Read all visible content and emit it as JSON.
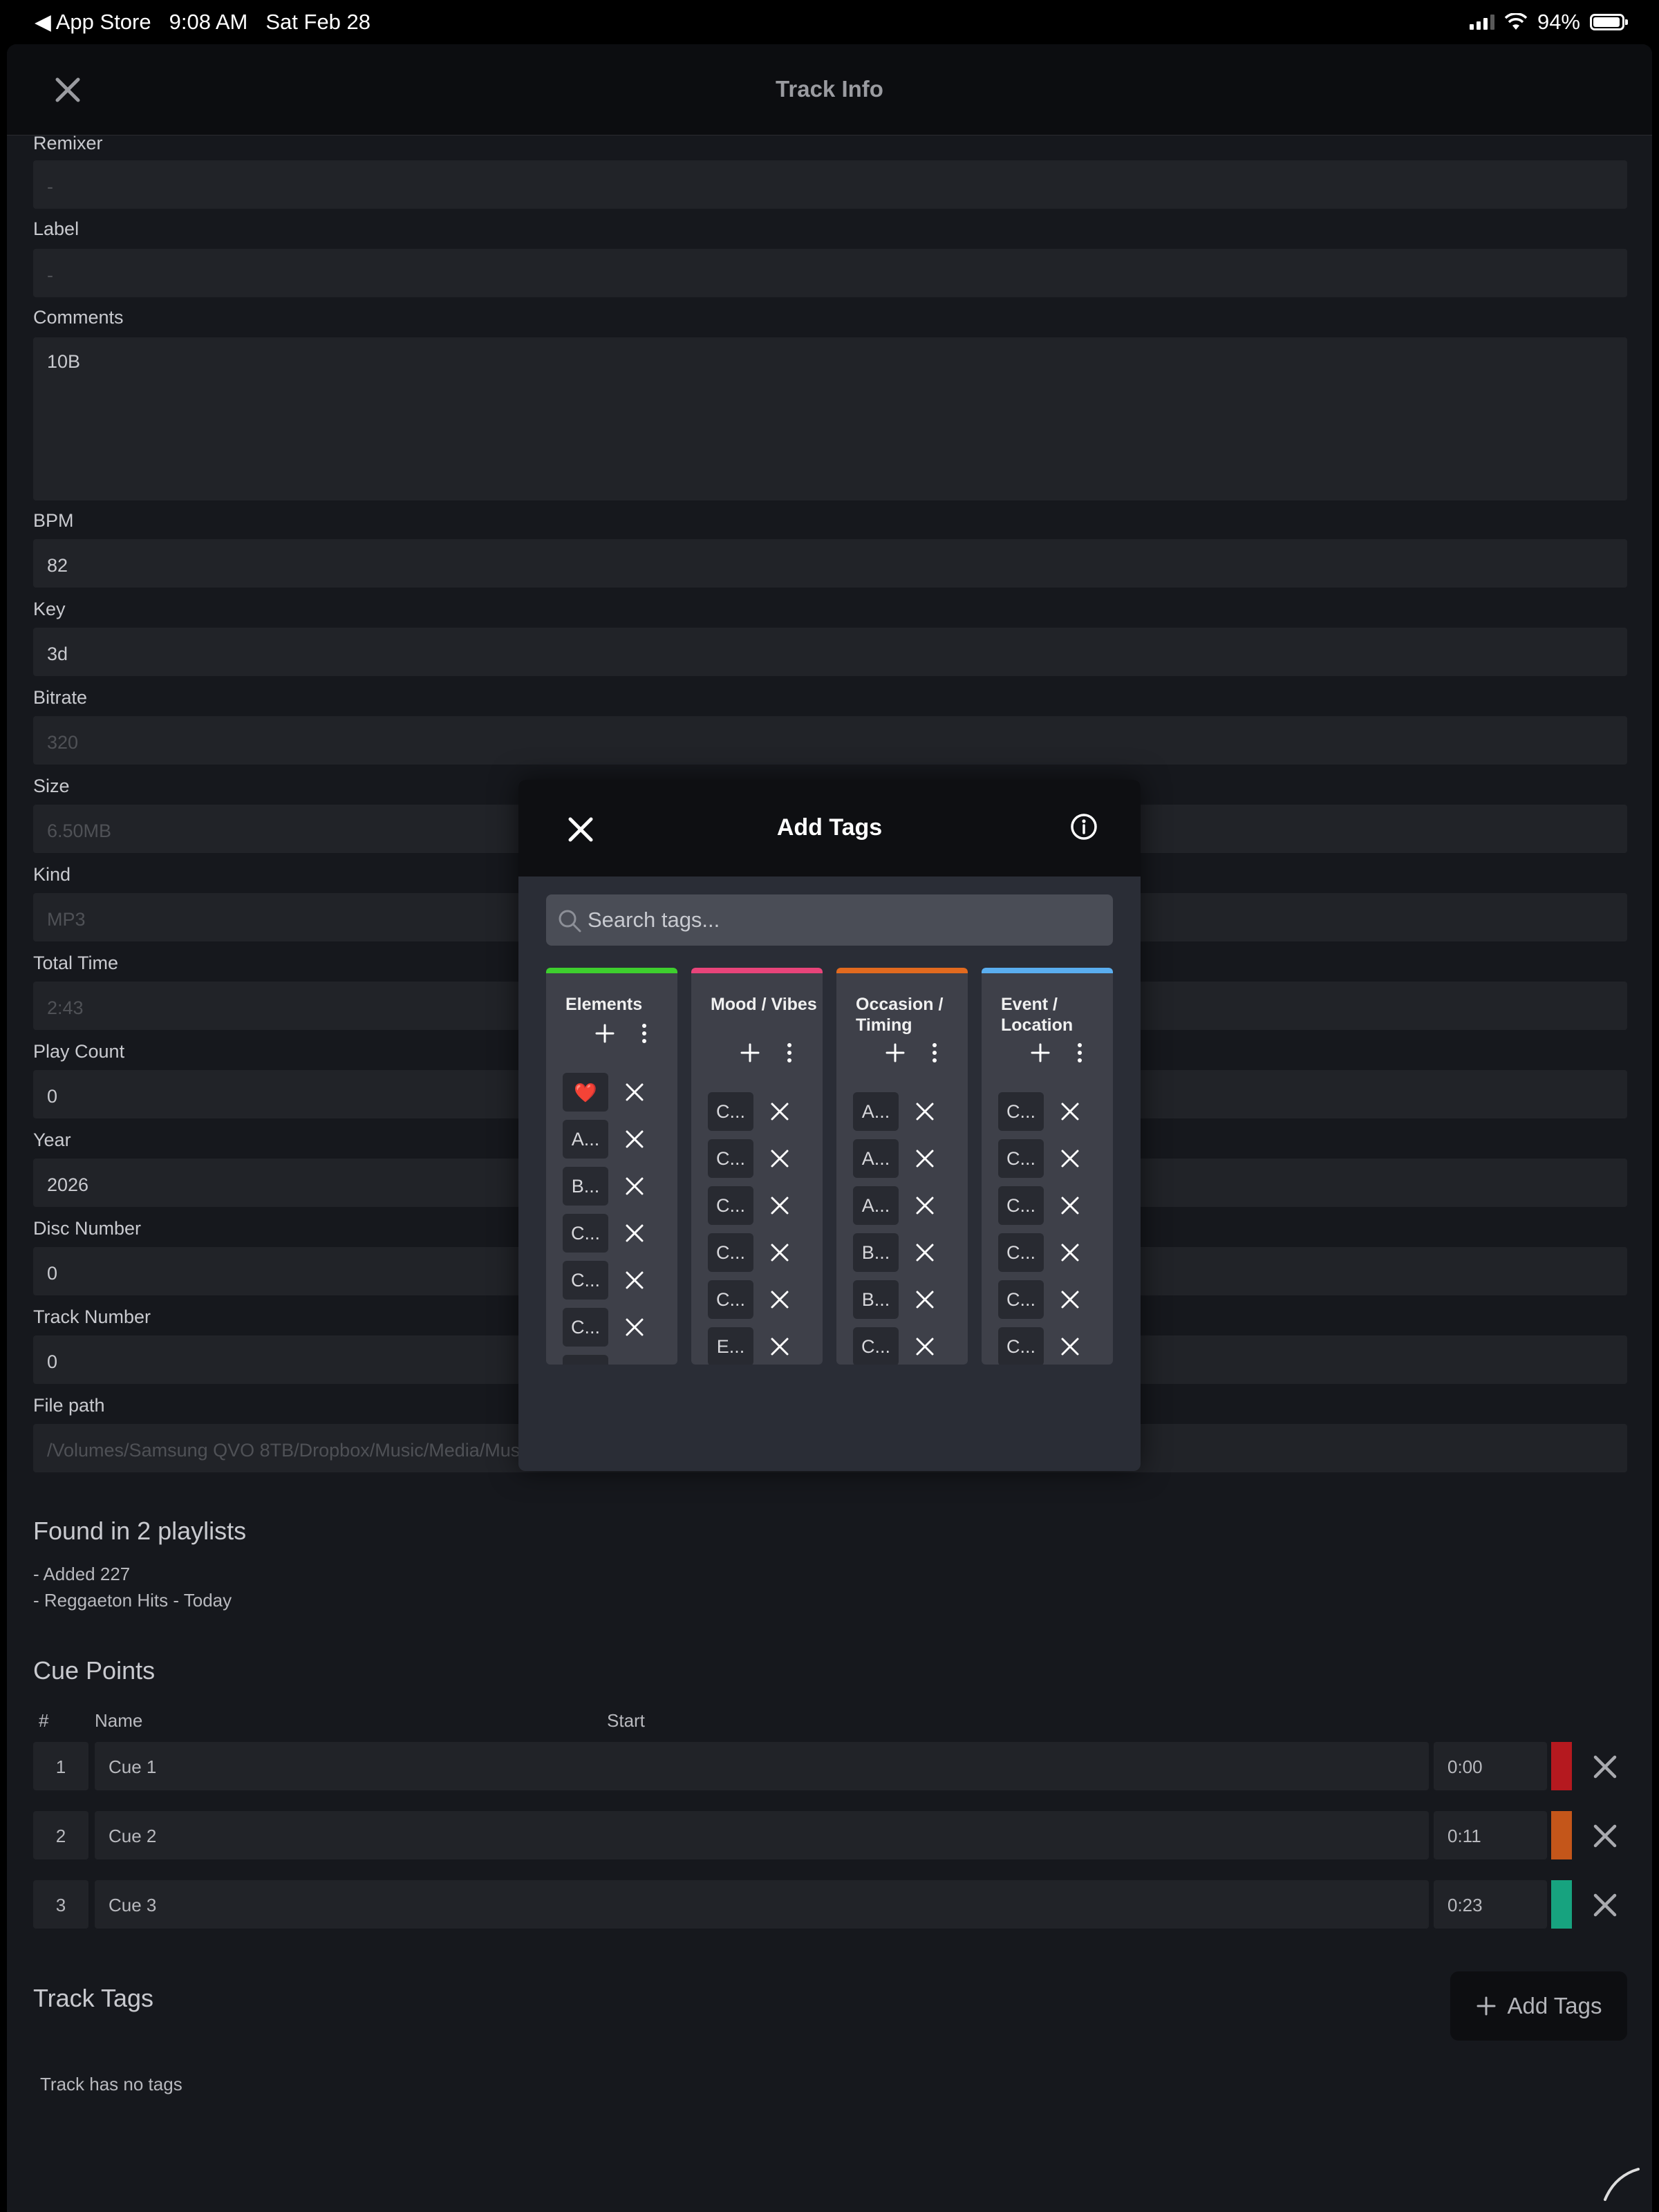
{
  "status_bar": {
    "back_app": "◀ App Store",
    "time": "9:08 AM",
    "date": "Sat Feb 28",
    "battery": "94%",
    "battery_fraction": 0.94
  },
  "header": {
    "title": "Track Info"
  },
  "fields": {
    "remixer": {
      "label": "Remixer",
      "value": "-"
    },
    "label": {
      "label": "Label",
      "value": "-"
    },
    "comments": {
      "label": "Comments",
      "value": "10B"
    },
    "bpm": {
      "label": "BPM",
      "value": "82"
    },
    "key": {
      "label": "Key",
      "value": "3d"
    },
    "bitrate": {
      "label": "Bitrate",
      "value": "320"
    },
    "size": {
      "label": "Size",
      "value": "6.50MB"
    },
    "kind": {
      "label": "Kind",
      "value": "MP3"
    },
    "total_time": {
      "label": "Total Time",
      "value": "2:43"
    },
    "play_count": {
      "label": "Play Count",
      "value": "0"
    },
    "year": {
      "label": "Year",
      "value": "2026"
    },
    "disc_number": {
      "label": "Disc Number",
      "value": "0"
    },
    "track_number": {
      "label": "Track Number",
      "value": "0"
    },
    "file_path": {
      "label": "File path",
      "value": "/Volumes/Samsung QVO 8TB/Dropbox/Music/Media/Music"
    }
  },
  "playlists": {
    "title": "Found in 2 playlists",
    "items": [
      "- Added 227",
      "- Reggaeton Hits - Today"
    ]
  },
  "cue_points": {
    "title": "Cue Points",
    "headers": {
      "num": "#",
      "name": "Name",
      "start": "Start"
    },
    "rows": [
      {
        "num": "1",
        "name": "Cue 1",
        "start": "0:00",
        "color": "#b5191f"
      },
      {
        "num": "2",
        "name": "Cue 2",
        "start": "0:11",
        "color": "#c4561a"
      },
      {
        "num": "3",
        "name": "Cue 3",
        "start": "0:23",
        "color": "#17a37f"
      }
    ]
  },
  "track_tags": {
    "title": "Track Tags",
    "add_button": "Add Tags",
    "empty_text": "Track has no tags"
  },
  "modal": {
    "title": "Add Tags",
    "search_placeholder": "Search tags...",
    "columns": [
      {
        "title": "Elements",
        "color": "#3ecf2e",
        "tags": [
          "❤️",
          "A...",
          "B...",
          "C...",
          "C...",
          "C..."
        ]
      },
      {
        "title": "Mood / Vibes",
        "color": "#e8447a",
        "tags": [
          "C...",
          "C...",
          "C...",
          "C...",
          "C...",
          "E..."
        ]
      },
      {
        "title": "Occasion / Timing",
        "color": "#e26a1f",
        "tags": [
          "A...",
          "A...",
          "A...",
          "B...",
          "B...",
          "C..."
        ]
      },
      {
        "title": "Event / Location",
        "color": "#5aaef0",
        "tags": [
          "C...",
          "C...",
          "C...",
          "C...",
          "C...",
          "C..."
        ]
      }
    ]
  },
  "icons": {
    "close": "close-icon",
    "info": "info-icon",
    "search": "search-icon",
    "plus": "plus-icon",
    "more": "more-vertical-icon"
  }
}
